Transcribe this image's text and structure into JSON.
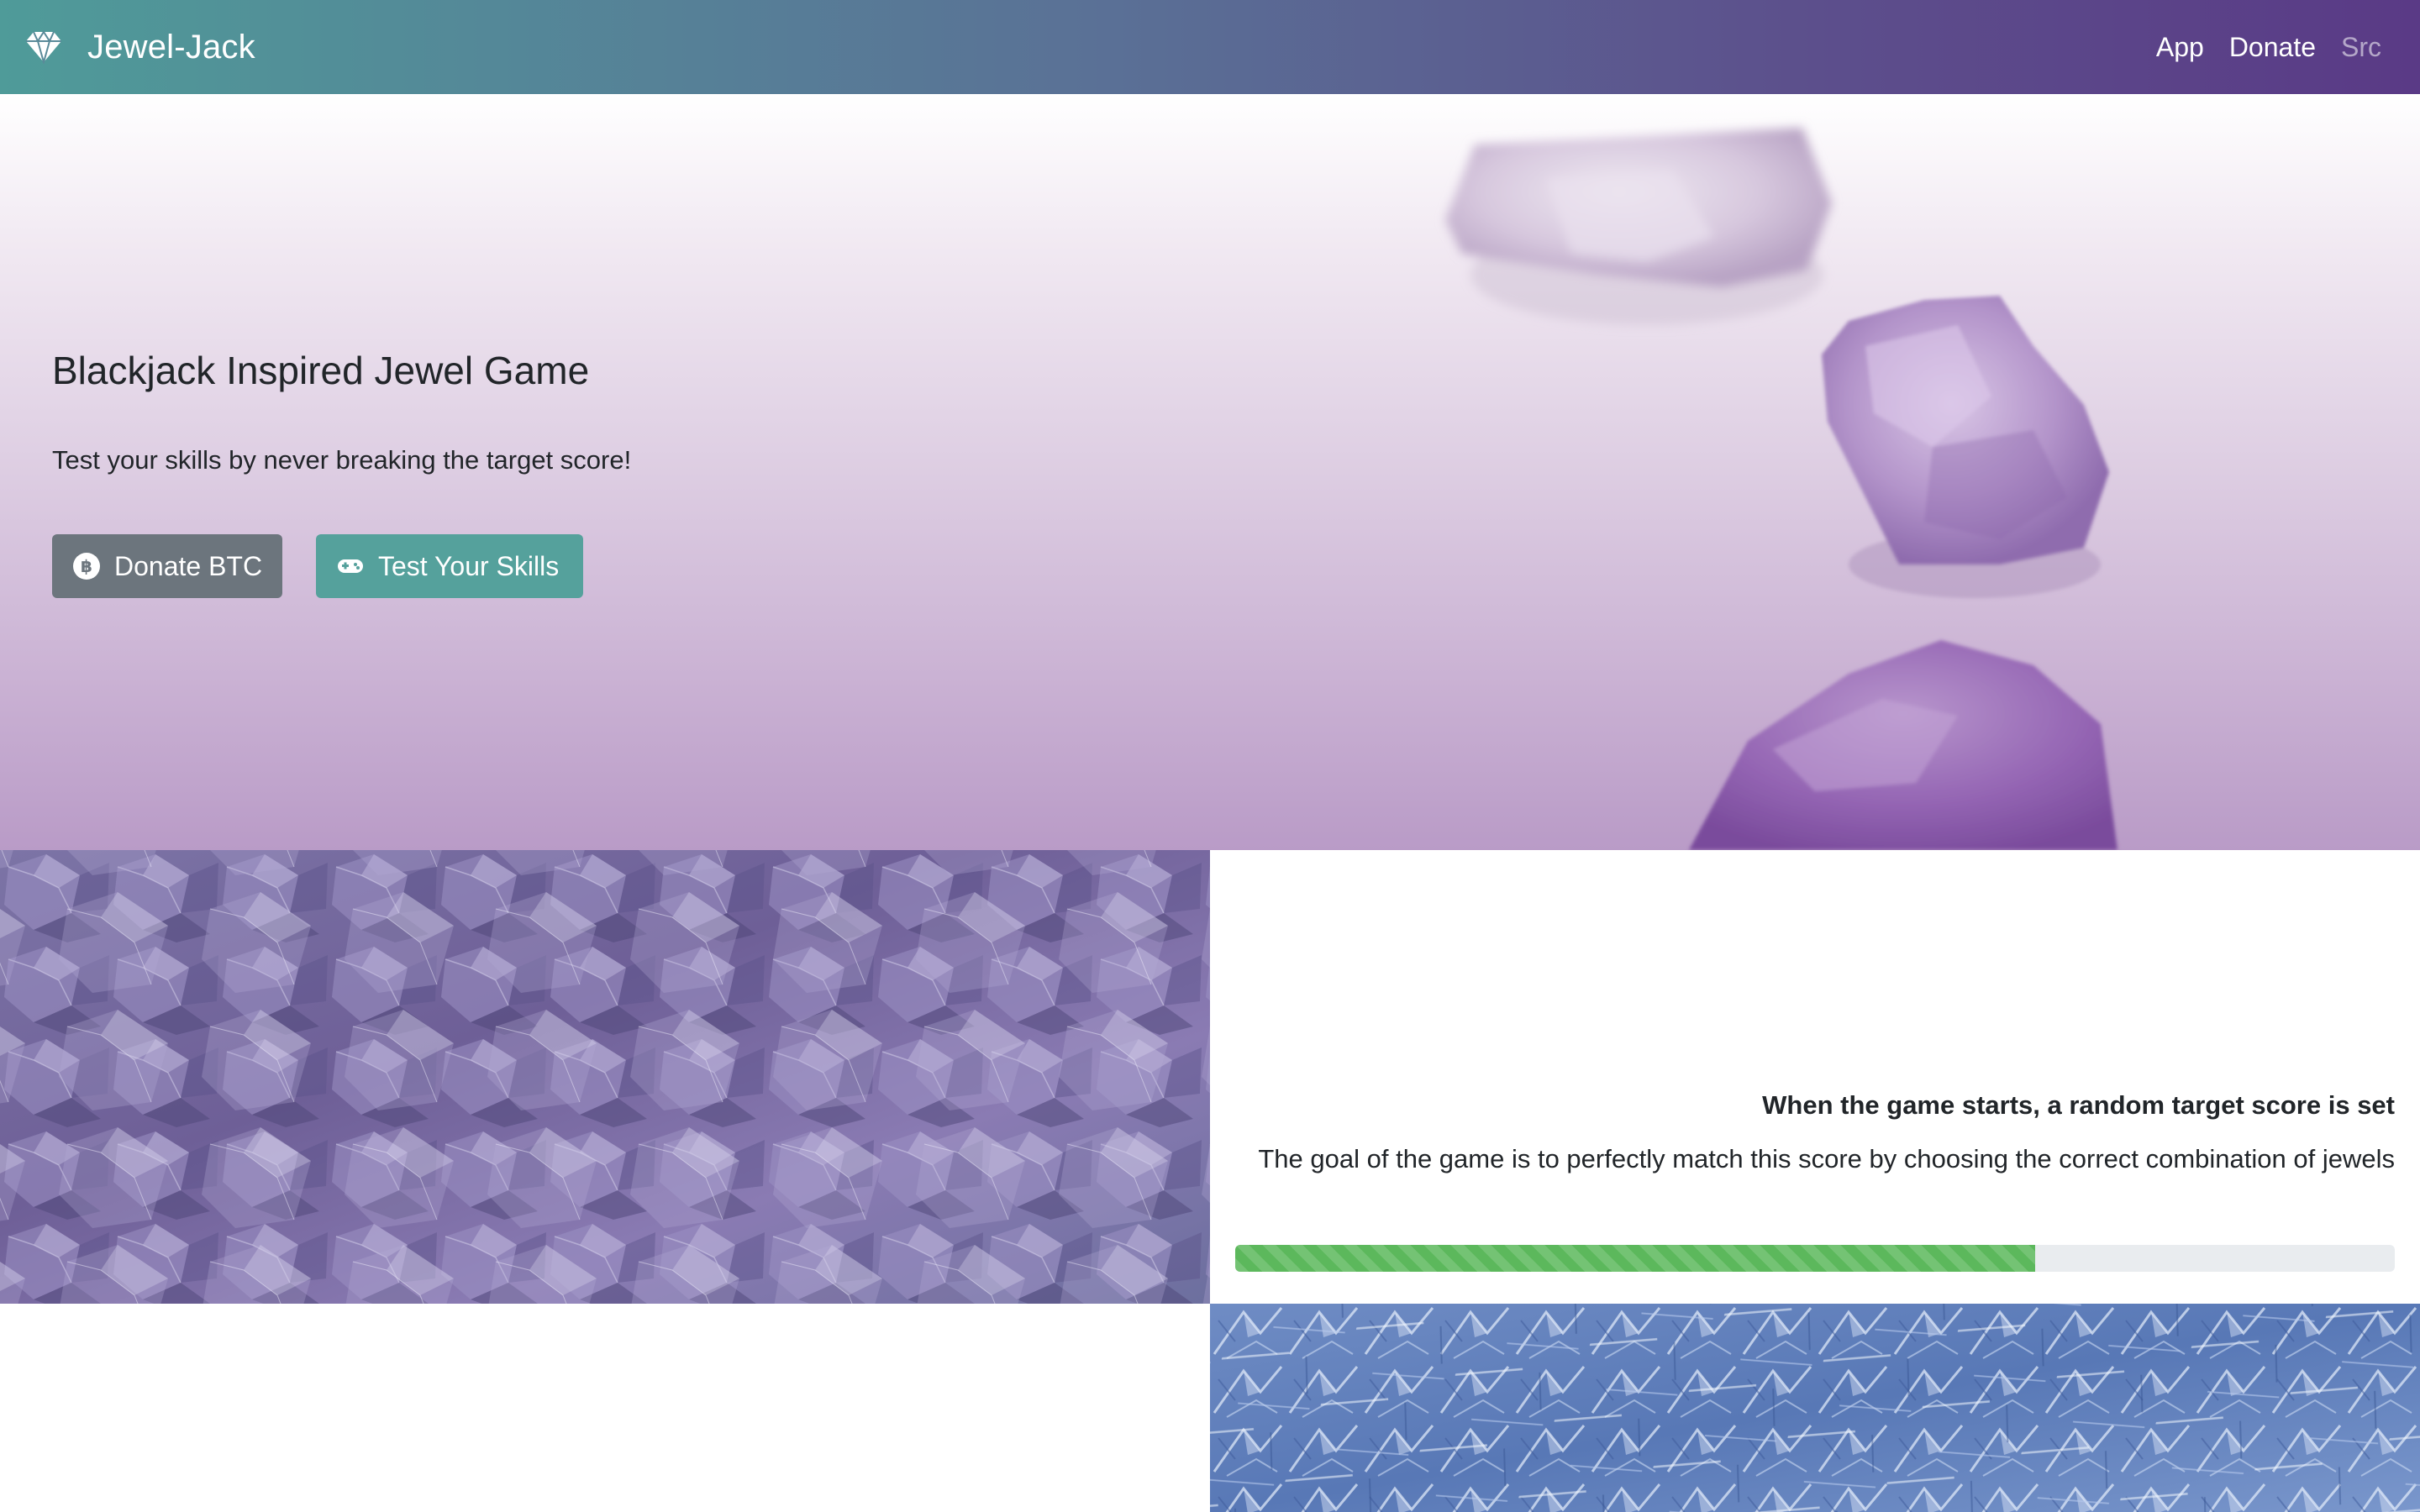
{
  "navbar": {
    "brand_icon": "gem-icon",
    "brand": "Jewel-Jack",
    "links": [
      {
        "label": "App",
        "active": true
      },
      {
        "label": "Donate",
        "active": true
      },
      {
        "label": "Src",
        "active": false
      }
    ],
    "gradient_colors": [
      "#4f9b99",
      "#5a3a86"
    ]
  },
  "hero": {
    "title": "Blackjack Inspired Jewel Game",
    "subtitle": "Test your skills by never breaking the target score!",
    "buttons": [
      {
        "label": "Donate BTC",
        "icon": "bitcoin-icon",
        "color": "#6c757d"
      },
      {
        "label": "Test Your Skills",
        "icon": "gamepad-icon",
        "color": "#55a19c"
      }
    ]
  },
  "info": {
    "heading": "When the game starts, a random target score is set",
    "body": "The goal of the game is to perfectly match this score by choosing the correct combination of jewels",
    "progress_fraction": 0.69,
    "progress_color": "#5cb85c"
  }
}
